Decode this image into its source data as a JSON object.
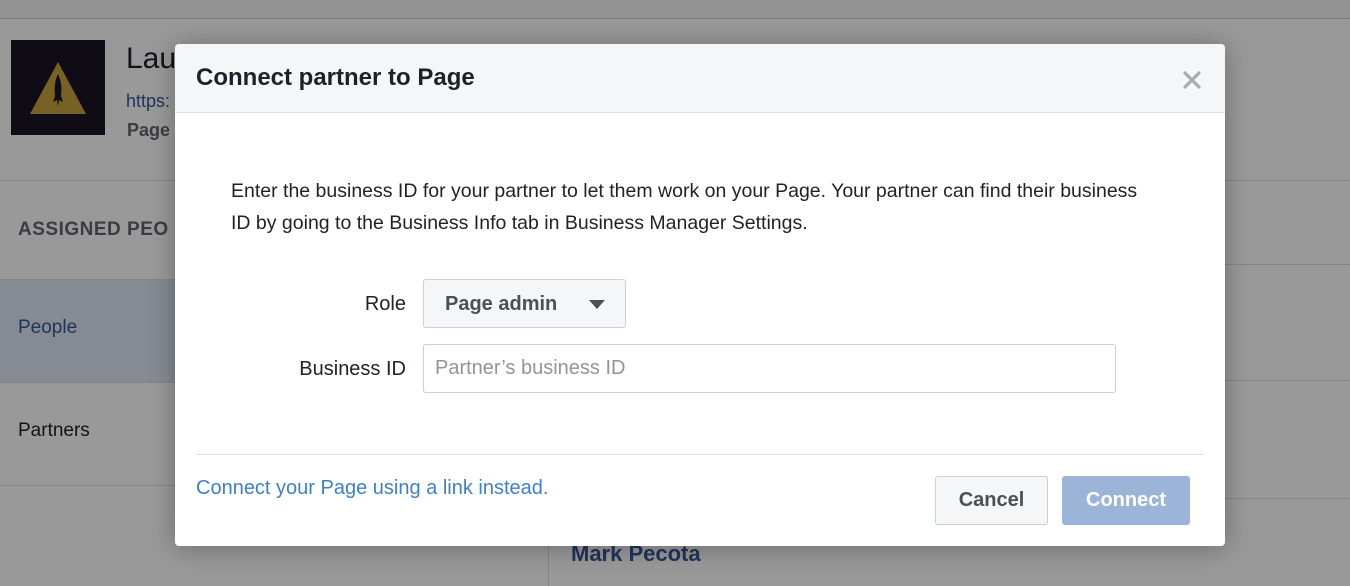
{
  "background": {
    "page_title": "Lau",
    "page_url": "https:",
    "page_subtitle": "Page",
    "section_title": "ASSIGNED PEO",
    "nav": {
      "people": "People",
      "partners": "Partners"
    },
    "person_name": "Mark Pecota"
  },
  "modal": {
    "title": "Connect partner to Page",
    "description": "Enter the business ID for your partner to let them work on your Page. Your partner can find their business ID by going to the Business Info tab in Business Manager Settings.",
    "role": {
      "label": "Role",
      "value": "Page admin"
    },
    "business_id": {
      "label": "Business ID",
      "placeholder": "Partner’s business ID",
      "value": ""
    },
    "link_text": "Connect your Page using a link instead.",
    "cancel_label": "Cancel",
    "connect_label": "Connect"
  },
  "icons": {
    "close": "close-icon",
    "caret": "caret-down-icon",
    "logo": "rocket-logo-icon"
  },
  "colors": {
    "link_blue": "#4080c4",
    "nav_active_bg": "#dfe7f5",
    "connect_disabled": "#9cb4d8",
    "logo_gold": "#c9a23c",
    "logo_bg": "#1c1426"
  }
}
